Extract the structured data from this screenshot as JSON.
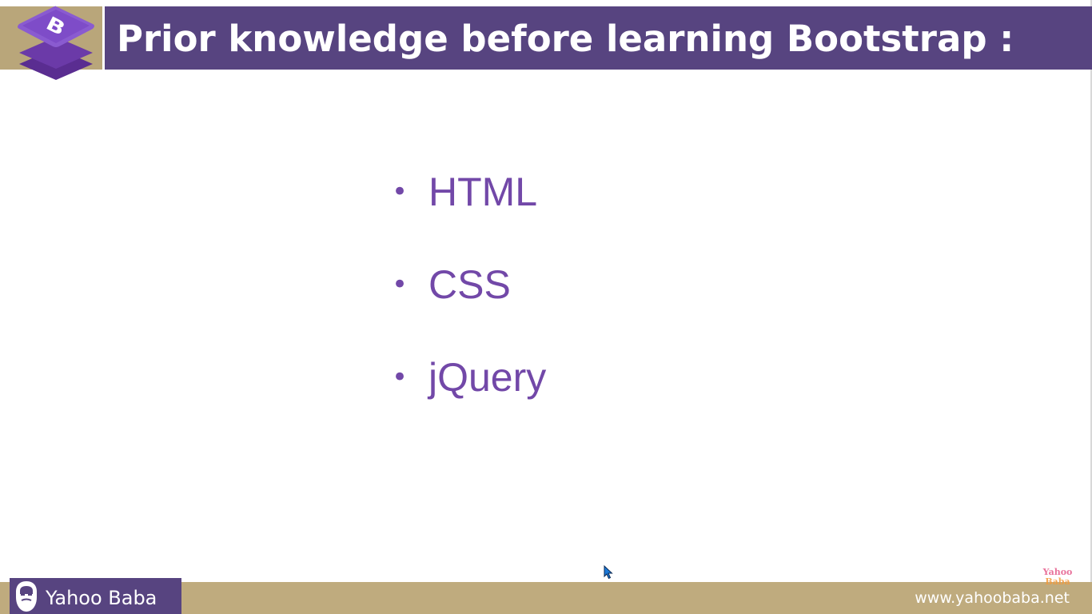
{
  "header": {
    "title": "Prior knowledge before learning Bootstrap :",
    "logo_icon": "bootstrap-logo-icon",
    "bar_color": "#574480",
    "accent_color": "#b9a67a"
  },
  "content": {
    "bullet_color": "#7248a8",
    "items": [
      {
        "label": "HTML"
      },
      {
        "label": "CSS"
      },
      {
        "label": "jQuery"
      }
    ]
  },
  "footer": {
    "brand_name": "Yahoo Baba",
    "brand_icon": "bearded-face-icon",
    "website": "www.yahoobaba.net",
    "watermark": {
      "line1": "Yahoo",
      "line2": "Baba"
    },
    "bar_color": "#bfab7e"
  }
}
